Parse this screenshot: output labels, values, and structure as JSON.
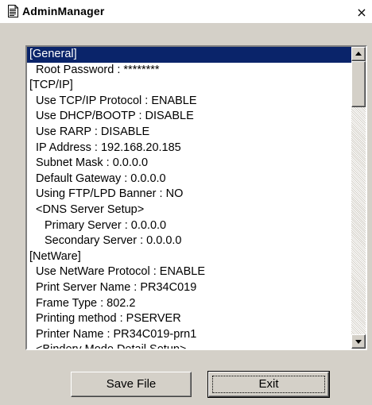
{
  "window": {
    "title": "AdminManager",
    "app_icon": "document-icon",
    "close_glyph": "×"
  },
  "settings_list": {
    "items": [
      {
        "text": "[General]",
        "level": 0,
        "selected": true
      },
      {
        "text": "Root Password : ********",
        "level": 1
      },
      {
        "text": "[TCP/IP]",
        "level": 0
      },
      {
        "text": "Use TCP/IP Protocol : ENABLE",
        "level": 1
      },
      {
        "text": "Use DHCP/BOOTP : DISABLE",
        "level": 1
      },
      {
        "text": "Use RARP : DISABLE",
        "level": 1
      },
      {
        "text": "IP Address : 192.168.20.185",
        "level": 1
      },
      {
        "text": "Subnet Mask : 0.0.0.0",
        "level": 1
      },
      {
        "text": "Default Gateway : 0.0.0.0",
        "level": 1
      },
      {
        "text": "Using FTP/LPD Banner : NO",
        "level": 1
      },
      {
        "text": "<DNS Server Setup>",
        "level": 1
      },
      {
        "text": "Primary Server : 0.0.0.0",
        "level": 2
      },
      {
        "text": "Secondary Server : 0.0.0.0",
        "level": 2
      },
      {
        "text": "[NetWare]",
        "level": 0
      },
      {
        "text": "Use NetWare Protocol : ENABLE",
        "level": 1
      },
      {
        "text": "Print Server Name : PR34C019",
        "level": 1
      },
      {
        "text": "Frame Type : 802.2",
        "level": 1
      },
      {
        "text": "Printing method : PSERVER",
        "level": 1
      },
      {
        "text": "Printer Name : PR34C019-prn1",
        "level": 1
      },
      {
        "text": "<Bindery Mode Detail Setup>",
        "level": 1
      }
    ]
  },
  "buttons": {
    "save_label": "Save File",
    "exit_label": "Exit"
  },
  "colors": {
    "selection": "#0a246a",
    "face": "#d4d0c8"
  }
}
